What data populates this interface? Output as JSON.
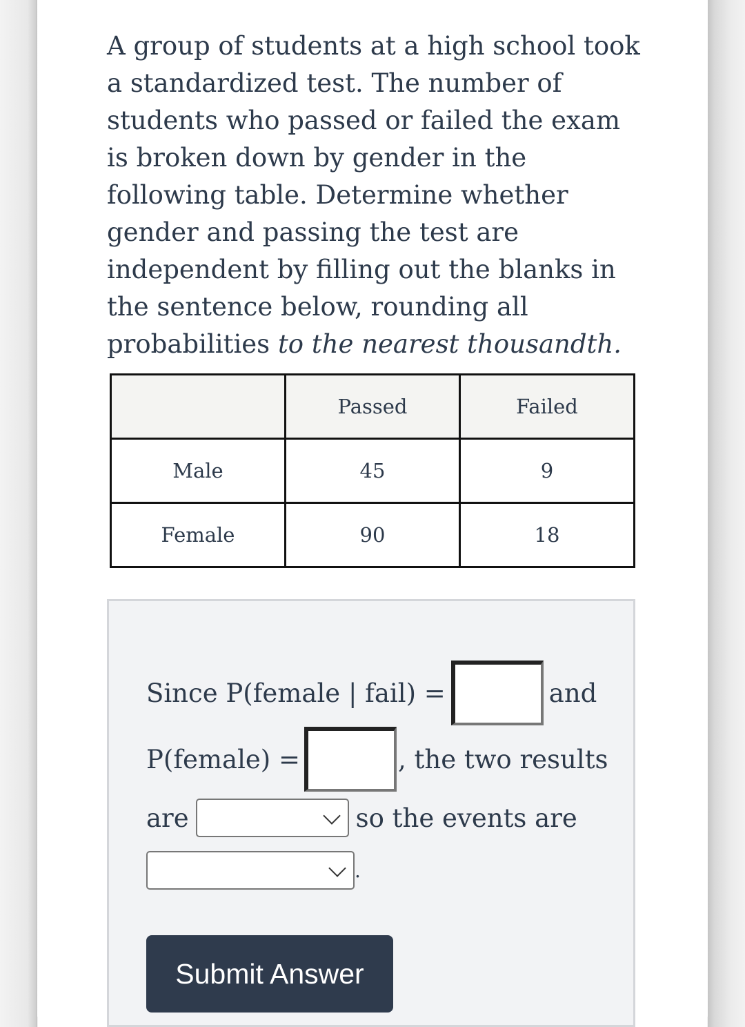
{
  "question": {
    "text_main": "A group of students at a high school took a standardized test. The number of students who passed or failed the exam is broken down by gender in the following table. Determine whether gender and passing the test are independent by filling out the blanks in the sentence below, rounding all probabilities ",
    "text_emphasis": "to the nearest thousandth.",
    "text_end": ""
  },
  "table": {
    "headers": [
      "",
      "Passed",
      "Failed"
    ],
    "rows": [
      [
        "Male",
        "45",
        "9"
      ],
      [
        "Female",
        "90",
        "18"
      ]
    ]
  },
  "answer": {
    "line1_prefix": "Since P(female | fail) =",
    "line1_suffix": "and",
    "line2_prefix": "P(female) =",
    "line2_suffix": ", the two results",
    "line3_prefix": "are",
    "line3_suffix": "so the events are",
    "line4_suffix": ".",
    "input1_value": "",
    "input2_value": "",
    "select1_value": "",
    "select2_value": ""
  },
  "submit_label": "Submit Answer"
}
